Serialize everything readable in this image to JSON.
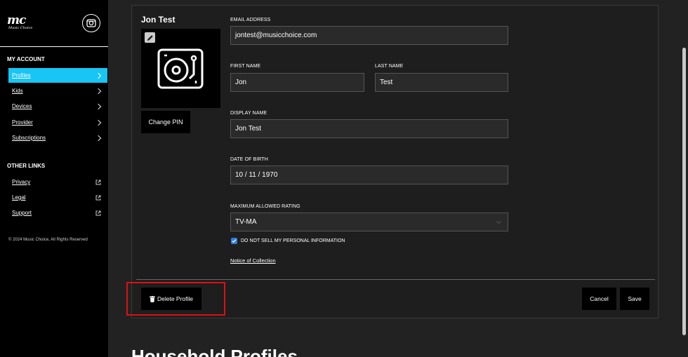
{
  "brand": {
    "logo_text": "mc",
    "logo_subtext": "Music Choice"
  },
  "sidebar": {
    "my_account_title": "MY ACCOUNT",
    "account_items": [
      {
        "label": "Profiles",
        "active": true
      },
      {
        "label": "Kids"
      },
      {
        "label": "Devices"
      },
      {
        "label": "Provider"
      },
      {
        "label": "Subscriptions"
      }
    ],
    "other_links_title": "OTHER LINKS",
    "other_links": [
      {
        "label": "Privacy"
      },
      {
        "label": "Legal"
      },
      {
        "label": "Support"
      }
    ],
    "copyright": "© 2024 Music Choice, All Rights Reserved"
  },
  "profile": {
    "name": "Jon Test",
    "change_pin_label": "Change PIN",
    "email_label": "EMAIL ADDRESS",
    "email_value": "jontest@musicchoice.com",
    "first_name_label": "FIRST NAME",
    "first_name_value": "Jon",
    "last_name_label": "LAST NAME",
    "last_name_value": "Test",
    "display_name_label": "DISPLAY NAME",
    "display_name_value": "Jon Test",
    "dob_label": "DATE OF BIRTH",
    "dob_value": "10 / 11 / 1970",
    "rating_label": "MAXIMUM ALLOWED RATING",
    "rating_value": "TV-MA",
    "do_not_sell_label": "DO NOT SELL MY PERSONAL INFORMATION",
    "do_not_sell_checked": true,
    "notice_link": "Notice of Collection"
  },
  "actions": {
    "delete_label": "Delete Profile",
    "cancel_label": "Cancel",
    "save_label": "Save"
  },
  "next_section_heading": "Household Profiles",
  "colors": {
    "accent": "#18c5f5",
    "highlight": "#e01010",
    "checkbox": "#2f7de1"
  }
}
